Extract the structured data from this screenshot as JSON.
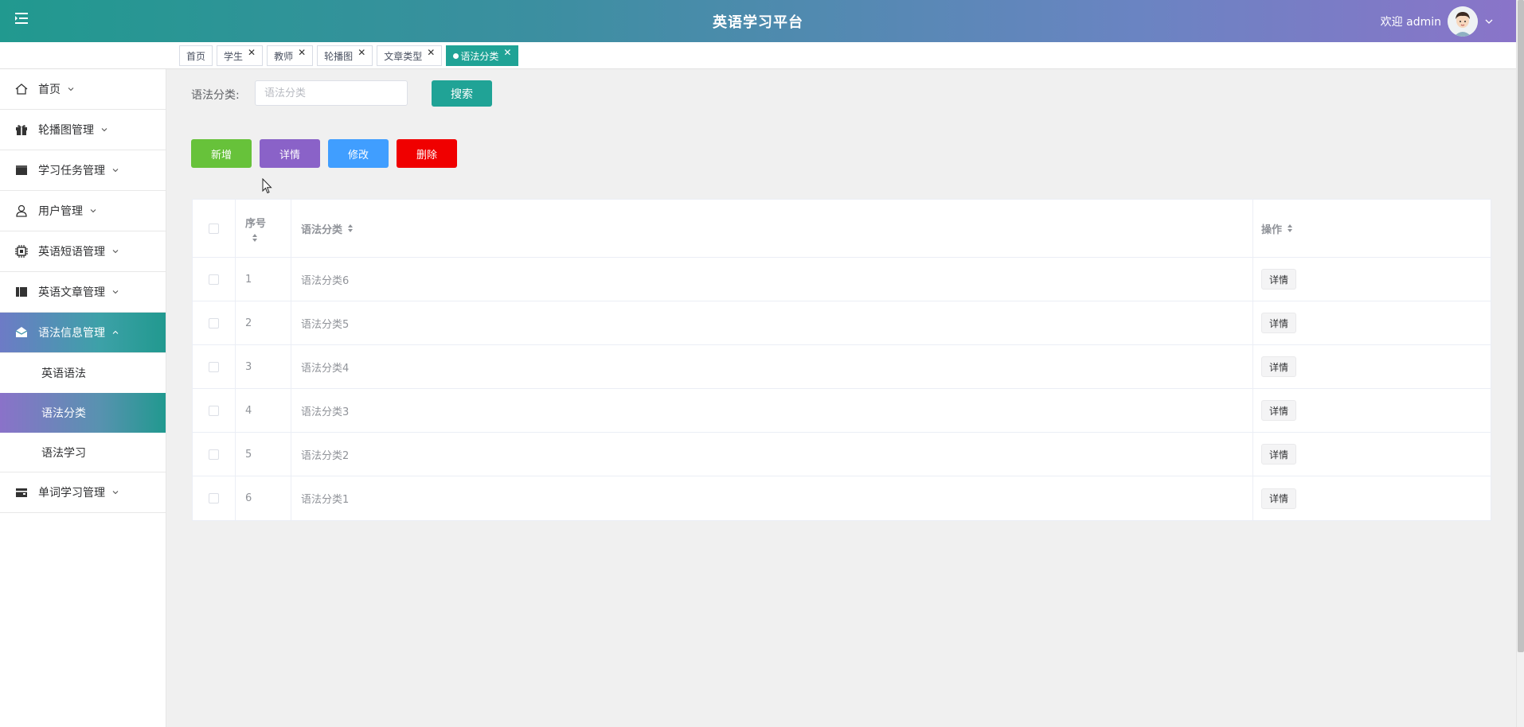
{
  "header": {
    "title": "英语学习平台",
    "welcome": "欢迎 admin",
    "menu_icon": "menu-fold-icon",
    "avatar_icon": "avatar-icon"
  },
  "tabs": [
    {
      "label": "首页",
      "closable": false,
      "active": false
    },
    {
      "label": "学生",
      "closable": true,
      "active": false
    },
    {
      "label": "教师",
      "closable": true,
      "active": false
    },
    {
      "label": "轮播图",
      "closable": true,
      "active": false
    },
    {
      "label": "文章类型",
      "closable": true,
      "active": false
    },
    {
      "label": "语法分类",
      "closable": true,
      "active": true
    }
  ],
  "sidebar": {
    "items": [
      {
        "label": "首页",
        "icon": "home-icon"
      },
      {
        "label": "轮播图管理",
        "icon": "gift-icon"
      },
      {
        "label": "学习任务管理",
        "icon": "task-icon"
      },
      {
        "label": "用户管理",
        "icon": "user-icon"
      },
      {
        "label": "英语短语管理",
        "icon": "chip-icon"
      },
      {
        "label": "英语文章管理",
        "icon": "book-icon"
      },
      {
        "label": "语法信息管理",
        "icon": "mail-icon",
        "open": true,
        "children": [
          {
            "label": "英语语法",
            "active": false
          },
          {
            "label": "语法分类",
            "active": true
          },
          {
            "label": "语法学习",
            "active": false
          }
        ]
      },
      {
        "label": "单词学习管理",
        "icon": "wallet-icon"
      }
    ]
  },
  "search": {
    "label": "语法分类:",
    "placeholder": "语法分类",
    "value": "",
    "button": "搜索"
  },
  "actions": {
    "add": "新增",
    "detail": "详情",
    "edit": "修改",
    "delete": "删除"
  },
  "table": {
    "headers": {
      "index": "序号",
      "name": "语法分类",
      "op": "操作"
    },
    "rows": [
      {
        "index": "1",
        "name": "语法分类6",
        "op": "详情"
      },
      {
        "index": "2",
        "name": "语法分类5",
        "op": "详情"
      },
      {
        "index": "3",
        "name": "语法分类4",
        "op": "详情"
      },
      {
        "index": "4",
        "name": "语法分类3",
        "op": "详情"
      },
      {
        "index": "5",
        "name": "语法分类2",
        "op": "详情"
      },
      {
        "index": "6",
        "name": "语法分类1",
        "op": "详情"
      }
    ]
  }
}
